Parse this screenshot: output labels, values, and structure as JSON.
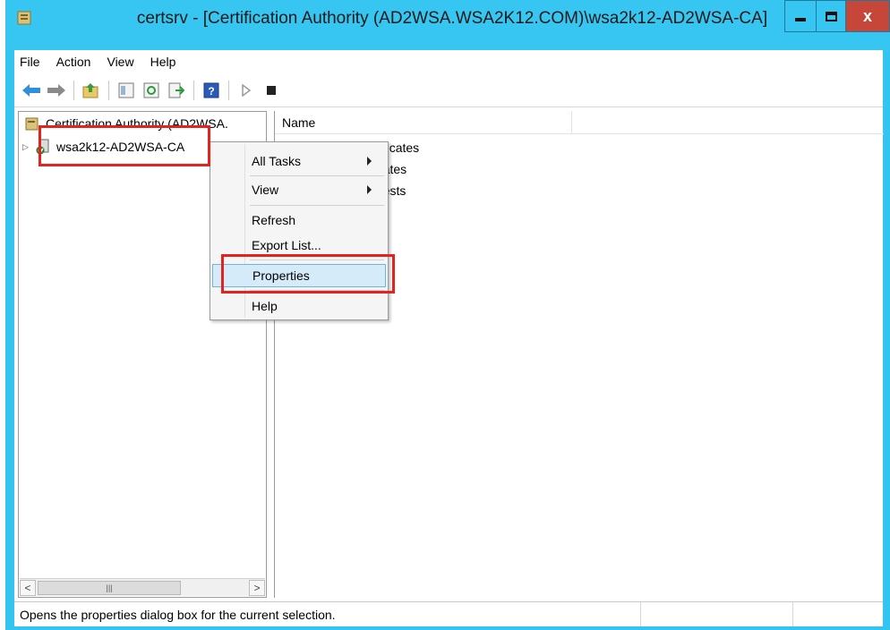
{
  "window": {
    "title": "certsrv - [Certification Authority (AD2WSA.WSA2K12.COM)\\wsa2k12-AD2WSA-CA]",
    "close_glyph": "x"
  },
  "menu": [
    "File",
    "Action",
    "View",
    "Help"
  ],
  "toolbar": {
    "icons": [
      "back-arrow-icon",
      "forward-arrow-icon",
      "up-folder-icon",
      "show-hide-tree-icon",
      "refresh-icon",
      "export-list-icon",
      "help-icon",
      "start-service-icon",
      "stop-service-icon"
    ]
  },
  "tree": {
    "root_label": "Certification Authority (AD2WSA.",
    "child_label": "wsa2k12-AD2WSA-CA"
  },
  "list": {
    "column_name": "Name",
    "items": [
      "Revoked Certificates",
      "Issued Certificates",
      "Pending Requests"
    ]
  },
  "context_menu": {
    "all_tasks": "All Tasks",
    "view": "View",
    "refresh": "Refresh",
    "export_list": "Export List...",
    "properties": "Properties",
    "help": "Help"
  },
  "statusbar": {
    "text": "Opens the properties dialog box for the current selection."
  },
  "colors": {
    "titlebar": "#37c6f1",
    "close_button": "#c7463a",
    "highlight": "#e3231f",
    "menu_hover": "#d5ebf9"
  }
}
